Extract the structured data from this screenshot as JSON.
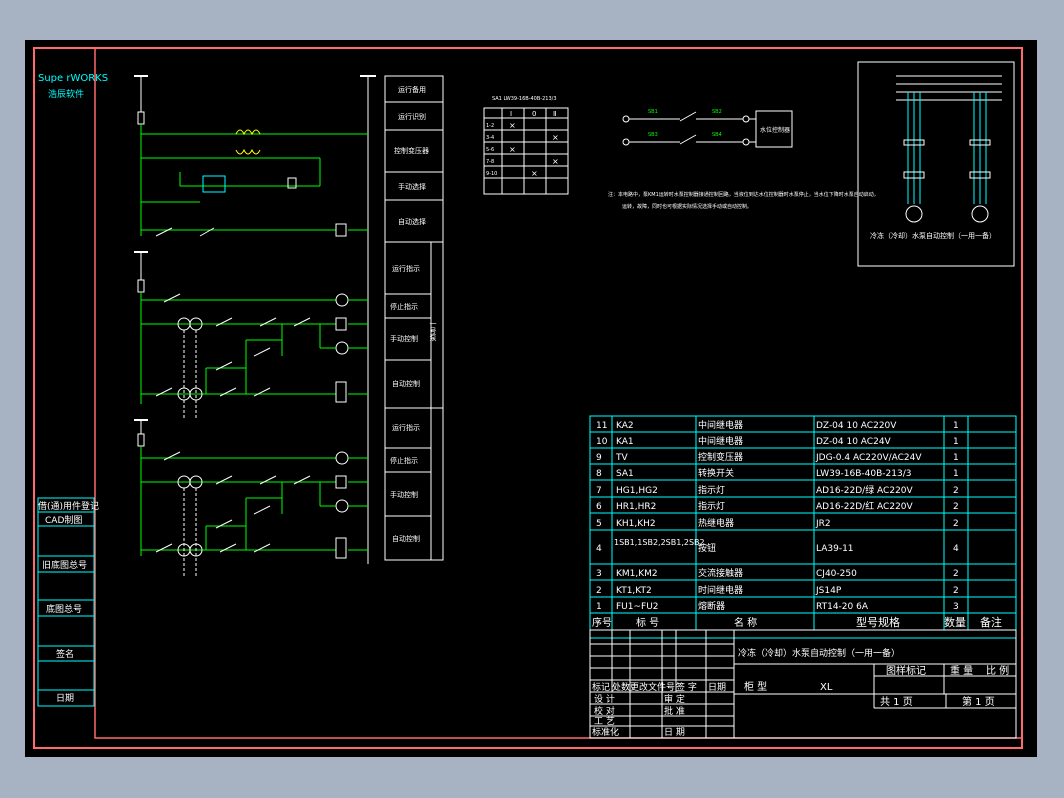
{
  "brand": {
    "line1": "Supe rWORKS",
    "line2": "浩辰软件"
  },
  "left_stamps": [
    "借(通)用件登记",
    "CAD制图",
    "旧底图总号",
    "底图总号",
    "签名",
    "日期"
  ],
  "coil_labels": [
    {
      "label": "运行备用"
    },
    {
      "label": "运行识别"
    },
    {
      "label": "控制变压器"
    },
    {
      "label": "手动选择"
    },
    {
      "label": "自动选择"
    },
    {
      "label": "运行指示"
    },
    {
      "label": "停止指示"
    },
    {
      "label": "手动控制"
    },
    {
      "label": "自动控制"
    },
    {
      "label": "运行指示"
    },
    {
      "label": "停止指示"
    },
    {
      "label": "手动控制"
    },
    {
      "label": "自动控制"
    }
  ],
  "coil_group_label": "一号泵",
  "switch_table": {
    "title": "SA1 LW39-16B-40B-213/3",
    "header": [
      "",
      "Ⅰ",
      "0",
      "Ⅱ"
    ],
    "rows": [
      [
        "1-2",
        "×",
        "",
        ""
      ],
      [
        "3-4",
        "",
        "",
        "×"
      ],
      [
        "5-6",
        "×",
        "",
        ""
      ],
      [
        "7-8",
        "",
        "",
        "×"
      ],
      [
        "9-10",
        "",
        "×",
        ""
      ]
    ]
  },
  "remote": {
    "box_label": "水位控制器",
    "labels": [
      "SB1",
      "SB2",
      "SB3",
      "SB4"
    ]
  },
  "note": "注：本电路中，泵KM1运转时水泵控制器接通控制回路，当液位到达水位控制器时水泵停止，当水位下降时水泵自动启动，",
  "note2": "运转，故障，同时也可根据实际情况选择手动或自动控制。",
  "motor_caption": "冷冻（冷却）水泵自动控制（一用一备）",
  "bom": {
    "header": {
      "no": "序号",
      "code": "标 号",
      "name": "名 称",
      "model": "型号规格",
      "qty": "数量",
      "remark": "备注"
    },
    "rows": [
      {
        "no": "11",
        "code": "KA2",
        "name": "中间继电器",
        "model": "DZ-04 10 AC220V",
        "qty": "1"
      },
      {
        "no": "10",
        "code": "KA1",
        "name": "中间继电器",
        "model": "DZ-04 10 AC24V",
        "qty": "1"
      },
      {
        "no": "9",
        "code": "TV",
        "name": "控制变压器",
        "model": "JDG-0.4 AC220V/AC24V",
        "qty": "1"
      },
      {
        "no": "8",
        "code": "SA1",
        "name": "转换开关",
        "model": "LW39-16B-40B-213/3",
        "qty": "1"
      },
      {
        "no": "7",
        "code": "HG1,HG2",
        "name": "指示灯",
        "model": "AD16-22D/绿 AC220V",
        "qty": "2"
      },
      {
        "no": "6",
        "code": "HR1,HR2",
        "name": "指示灯",
        "model": "AD16-22D/红 AC220V",
        "qty": "2"
      },
      {
        "no": "5",
        "code": "KH1,KH2",
        "name": "热继电器",
        "model": "JR2",
        "qty": "2"
      },
      {
        "no": "4",
        "code": "1SB1,1SB2,2SB1,2SB2",
        "name": "按钮",
        "model": "LA39-11",
        "qty": "4"
      },
      {
        "no": "3",
        "code": "KM1,KM2",
        "name": "交流接触器",
        "model": "CJ40-250",
        "qty": "2"
      },
      {
        "no": "2",
        "code": "KT1,KT2",
        "name": "时间继电器",
        "model": "JS14P",
        "qty": "2"
      },
      {
        "no": "1",
        "code": "FU1~FU2",
        "name": "熔断器",
        "model": "RT14-20 6A",
        "qty": "3"
      }
    ]
  },
  "title_block": {
    "drawing_title": "冷冻（冷却）水泵自动控制（一用一备）",
    "stage_mark": "图样标记",
    "weight": "重 量",
    "scale": "比 例",
    "cabinet_label": "柜 型",
    "cabinet_value": "XL",
    "sheets_total": "共 1 页",
    "sheet_no": "第 1 页",
    "rev_headers": [
      "标记",
      "处数",
      "更改文件号",
      "签 字",
      "日期"
    ],
    "roles_left": [
      "设 计",
      "校 对",
      "工 艺",
      "标准化"
    ],
    "roles_right": [
      "审 定",
      "批 准",
      "",
      "日 期"
    ]
  }
}
